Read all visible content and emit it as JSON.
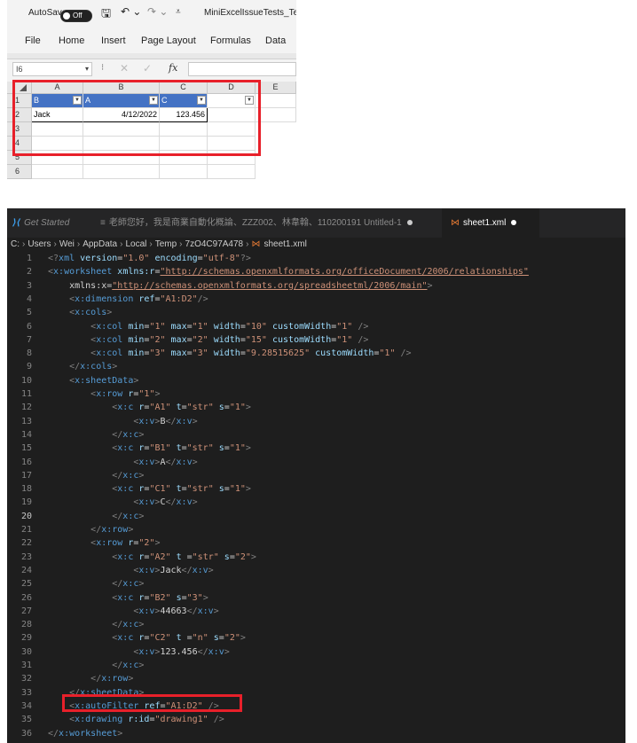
{
  "excel": {
    "autosave_label": "AutoSave",
    "autosave_state": "Off",
    "filename": "MiniExcelIssueTests_Te",
    "menu": [
      "File",
      "Home",
      "Insert",
      "Page Layout",
      "Formulas",
      "Data"
    ],
    "name_box": "I6",
    "fx": "fx",
    "columns": [
      "A",
      "B",
      "C",
      "D",
      "E"
    ],
    "rows": [
      "1",
      "2",
      "3",
      "4",
      "5",
      "6"
    ],
    "header_row": [
      "B",
      "A",
      "C"
    ],
    "data_row": [
      "Jack",
      "4/12/2022",
      "123.456"
    ],
    "header_fill": "#4472c4",
    "highlight_color": "#e8202a"
  },
  "vscode": {
    "tabs": [
      {
        "label": "Get Started",
        "active": false
      },
      {
        "label": "老師您好，我是商業自動化概論、ZZZ002、林韋翰、110200191 Untitled-1",
        "active": false
      },
      {
        "label": "sheet1.xml",
        "active": true
      }
    ],
    "breadcrumb": [
      "C:",
      "Users",
      "Wei",
      "AppData",
      "Local",
      "Temp",
      "7zO4C97A478",
      "sheet1.xml"
    ],
    "current_line": 20,
    "highlighted_line": 34,
    "lines": [
      "<?xml version=\"1.0\" encoding=\"utf-8\"?>",
      "<x:worksheet xmlns:r=\"http://schemas.openxmlformats.org/officeDocument/2006/relationships\"",
      "    xmlns:x=\"http://schemas.openxmlformats.org/spreadsheetml/2006/main\">",
      "    <x:dimension ref=\"A1:D2\"/>",
      "    <x:cols>",
      "        <x:col min=\"1\" max=\"1\" width=\"10\" customWidth=\"1\" />",
      "        <x:col min=\"2\" max=\"2\" width=\"15\" customWidth=\"1\" />",
      "        <x:col min=\"3\" max=\"3\" width=\"9.28515625\" customWidth=\"1\" />",
      "    </x:cols>",
      "    <x:sheetData>",
      "        <x:row r=\"1\">",
      "            <x:c r=\"A1\" t=\"str\" s=\"1\">",
      "                <x:v>B</x:v>",
      "            </x:c>",
      "            <x:c r=\"B1\" t=\"str\" s=\"1\">",
      "                <x:v>A</x:v>",
      "            </x:c>",
      "            <x:c r=\"C1\" t=\"str\" s=\"1\">",
      "                <x:v>C</x:v>",
      "            </x:c>",
      "        </x:row>",
      "        <x:row r=\"2\">",
      "            <x:c r=\"A2\" t =\"str\" s=\"2\">",
      "                <x:v>Jack</x:v>",
      "            </x:c>",
      "            <x:c r=\"B2\" s=\"3\">",
      "                <x:v>44663</x:v>",
      "            </x:c>",
      "            <x:c r=\"C2\" t =\"n\" s=\"2\">",
      "                <x:v>123.456</x:v>",
      "            </x:c>",
      "        </x:row>",
      "    </x:sheetData>",
      "    <x:autoFilter ref=\"A1:D2\" />",
      "    <x:drawing r:id=\"drawing1\" />",
      "</x:worksheet>"
    ]
  }
}
